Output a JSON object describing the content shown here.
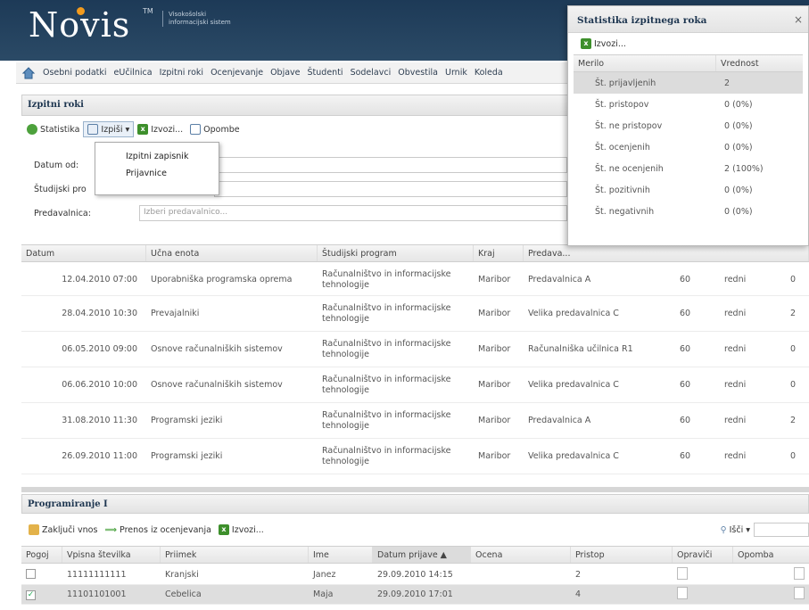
{
  "header": {
    "logo": "Novis",
    "tm": "TM",
    "tagline": "Visokošolski informacijski sistem"
  },
  "nav": [
    "Osebni podatki",
    "eUčilnica",
    "Izpitni roki",
    "Ocenjevanje",
    "Objave",
    "Študenti",
    "Sodelavci",
    "Obvestila",
    "Urnik",
    "Koleda"
  ],
  "exam_panel": {
    "title": "Izpitni roki",
    "toolbar": {
      "stats": "Statistika",
      "prints": "Izpiši",
      "export": "Izvozi...",
      "notes": "Opombe"
    },
    "dropdown": [
      "Izpitni zapisnik",
      "Prijavnice"
    ],
    "form": {
      "date_from_label": "Datum od:",
      "program_label": "Študijski pro",
      "room_label": "Predavalnica:",
      "room_placeholder": "Izberi predavalnico..."
    },
    "columns": [
      "Datum",
      "Učna enota",
      "Študijski program",
      "Kraj",
      "Predava..."
    ],
    "rows": [
      {
        "date": "12.04.2010 07:00",
        "unit": "Uporabniška programska oprema",
        "program": "Računalništvo in informacijske tehnologije",
        "place": "Maribor",
        "room": "Predavalnica A",
        "cap": "60",
        "type": "redni",
        "n": "0"
      },
      {
        "date": "28.04.2010 10:30",
        "unit": "Prevajalniki",
        "program": "Računalništvo in informacijske tehnologije",
        "place": "Maribor",
        "room": "Velika predavalnica C",
        "cap": "60",
        "type": "redni",
        "n": "2"
      },
      {
        "date": "06.05.2010 09:00",
        "unit": "Osnove računalniških sistemov",
        "program": "Računalništvo in informacijske tehnologije",
        "place": "Maribor",
        "room": "Računalniška učilnica R1",
        "cap": "60",
        "type": "redni",
        "n": "0"
      },
      {
        "date": "06.06.2010 10:00",
        "unit": "Osnove računalniških sistemov",
        "program": "Računalništvo in informacijske tehnologije",
        "place": "Maribor",
        "room": "Velika predavalnica C",
        "cap": "60",
        "type": "redni",
        "n": "0"
      },
      {
        "date": "31.08.2010 11:30",
        "unit": "Programski jeziki",
        "program": "Računalništvo in informacijske tehnologije",
        "place": "Maribor",
        "room": "Predavalnica A",
        "cap": "60",
        "type": "redni",
        "n": "2"
      },
      {
        "date": "26.09.2010 11:00",
        "unit": "Programski jeziki",
        "program": "Računalništvo in informacijske tehnologije",
        "place": "Maribor",
        "room": "Velika predavalnica C",
        "cap": "60",
        "type": "redni",
        "n": "0"
      }
    ]
  },
  "stats": {
    "title": "Statistika izpitnega roka",
    "close": "×",
    "export": "Izvozi...",
    "col_metric": "Merilo",
    "col_value": "Vrednost",
    "rows": [
      {
        "m": "Št. prijavljenih",
        "v": "2"
      },
      {
        "m": "Št. pristopov",
        "v": "0 (0%)"
      },
      {
        "m": "Št. ne pristopov",
        "v": "0 (0%)"
      },
      {
        "m": "Št. ocenjenih",
        "v": "0 (0%)"
      },
      {
        "m": "Št. ne ocenjenih",
        "v": "2 (100%)"
      },
      {
        "m": "Št. pozitivnih",
        "v": "0 (0%)"
      },
      {
        "m": "Št. negativnih",
        "v": "0 (0%)"
      }
    ]
  },
  "prog_panel": {
    "title": "Programiranje I",
    "toolbar": {
      "close": "Zaključi vnos",
      "transfer": "Prenos iz ocenjevanja",
      "export": "Izvozi...",
      "search": "Išči"
    },
    "columns": [
      "Pogoj",
      "Vpisna številka",
      "Priimek",
      "Ime",
      "Datum prijave ▲",
      "Ocena",
      "Pristop",
      "Opraviči",
      "Opomba"
    ],
    "rows": [
      {
        "check": "",
        "id": "11111111111",
        "surname": "Kranjski",
        "name": "Janez",
        "date": "29.09.2010 14:15",
        "grade": "",
        "attend": "2"
      },
      {
        "check": "✓",
        "id": "11101101001",
        "surname": "Čebelica",
        "name": "Maja",
        "date": "29.09.2010 17:01",
        "grade": "",
        "attend": "4"
      }
    ]
  }
}
